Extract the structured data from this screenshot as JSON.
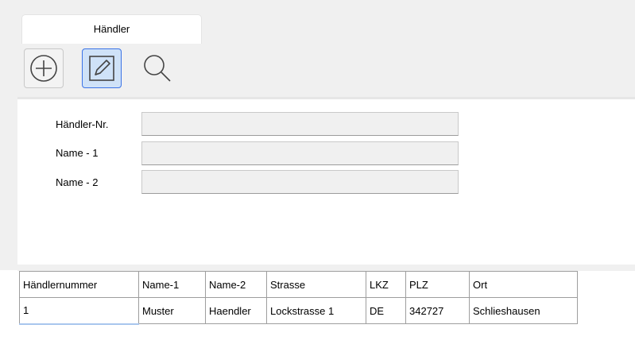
{
  "tabs": [
    {
      "label": "Händler"
    }
  ],
  "toolbar": {
    "add_icon": "plus-circle-icon",
    "edit_icon": "pencil-edit-icon",
    "search_icon": "magnifier-icon"
  },
  "form": {
    "fields": [
      {
        "label": "Händler-Nr.",
        "value": ""
      },
      {
        "label": "Name - 1",
        "value": ""
      },
      {
        "label": "Name - 2",
        "value": ""
      }
    ]
  },
  "grid": {
    "columns": [
      "Händlernummer",
      "Name-1",
      "Name-2",
      "Strasse",
      "LKZ",
      "PLZ",
      "Ort"
    ],
    "rows": [
      [
        "1",
        "Muster",
        "Haendler",
        "Lockstrasse 1",
        "DE",
        "342727",
        "Schlieshausen"
      ]
    ]
  },
  "colors": {
    "window_bg": "#f0f0f0",
    "active_button_bg": "#cfe2f8",
    "active_button_border": "#3b73e6",
    "grid_border": "#9e9e9e"
  }
}
